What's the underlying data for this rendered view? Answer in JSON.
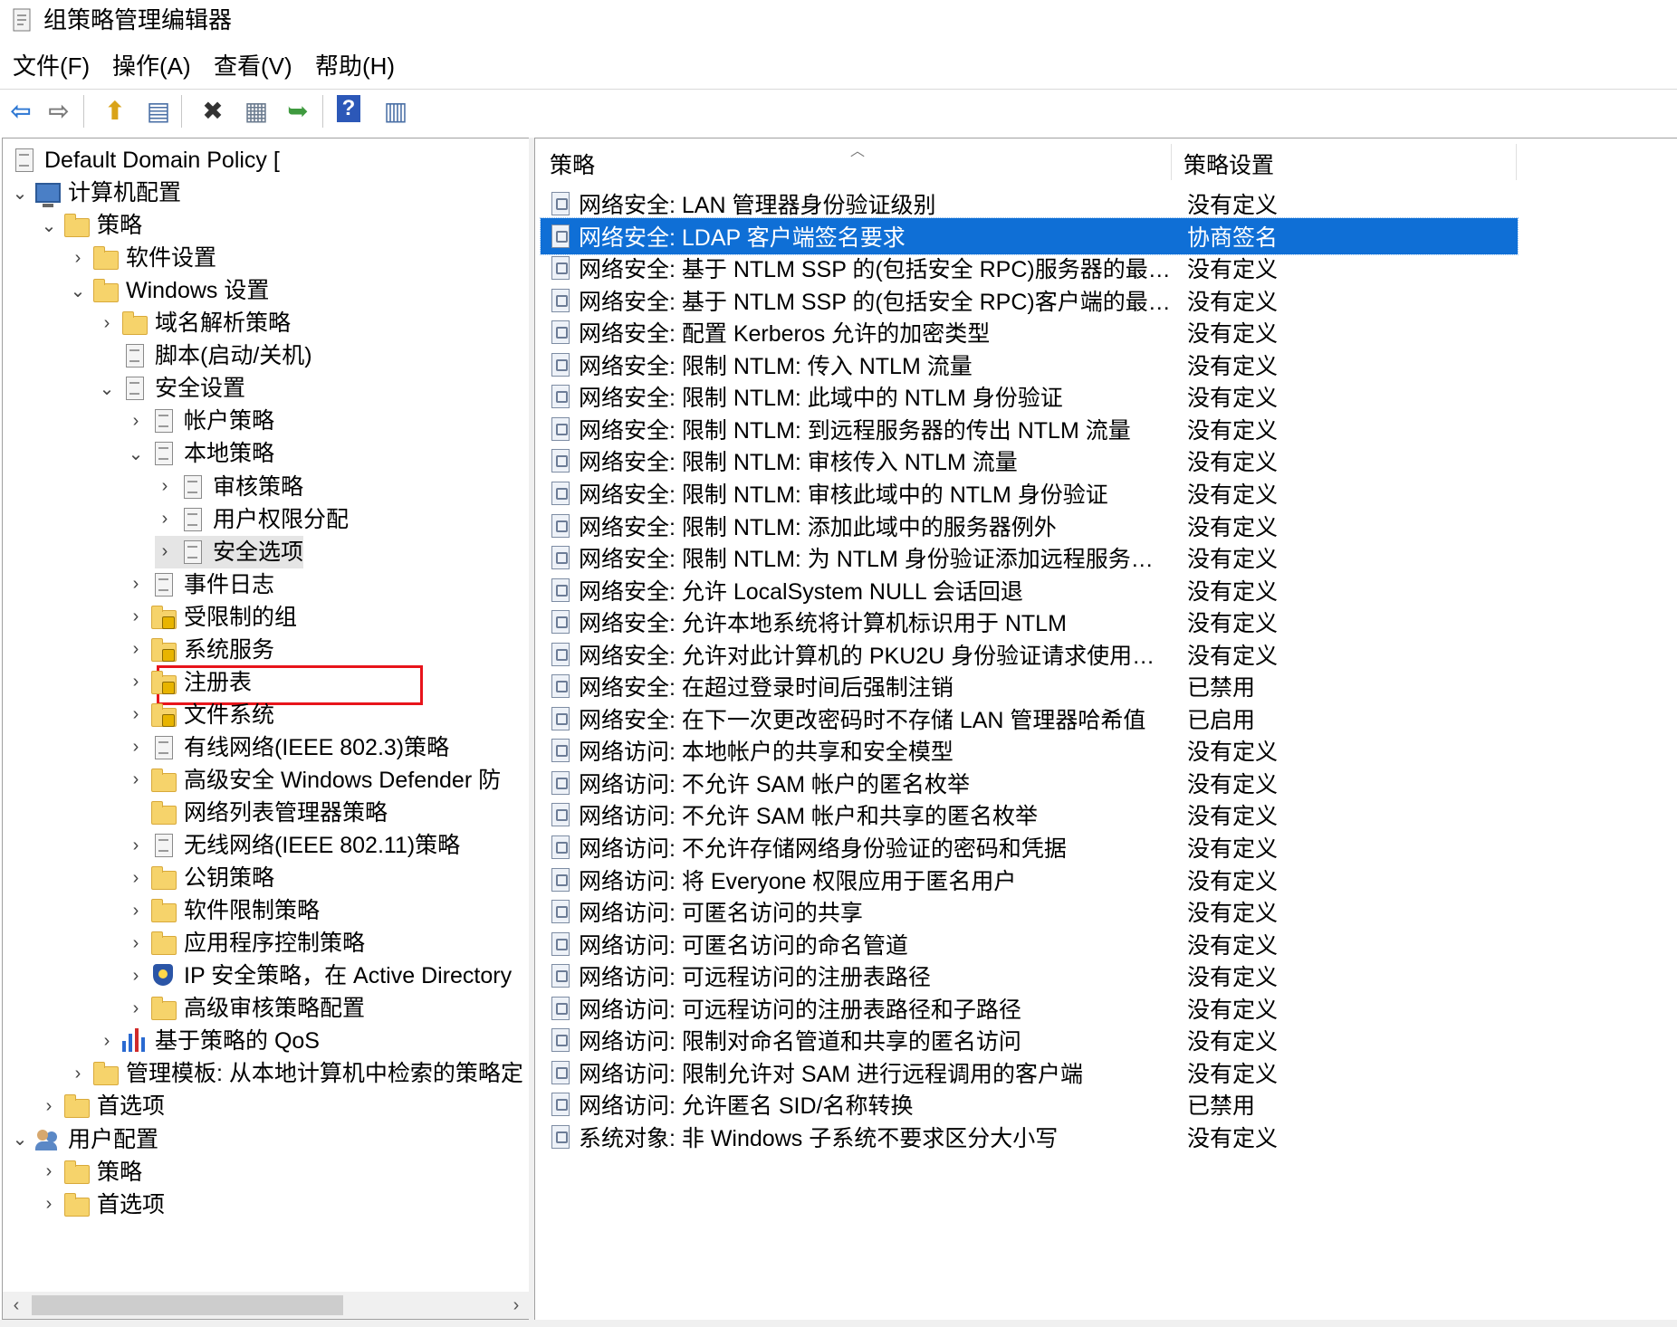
{
  "window": {
    "title": "组策略管理编辑器",
    "icon": "gpo-editor-icon"
  },
  "menu": [
    "文件(F)",
    "操作(A)",
    "查看(V)",
    "帮助(H)"
  ],
  "toolbar": [
    {
      "name": "back-icon",
      "glyph": "⇦",
      "color": "#2d77d3"
    },
    {
      "name": "forward-icon",
      "glyph": "⇨",
      "color": "#7a7a7a"
    },
    {
      "name": "up-folder-icon",
      "glyph": "⬆",
      "color": "#d9a319"
    },
    {
      "name": "show-hide-tree-icon",
      "glyph": "▤",
      "color": "#4a6fa5"
    },
    {
      "name": "delete-icon",
      "glyph": "✖",
      "color": "#333333"
    },
    {
      "name": "properties-icon",
      "glyph": "▦",
      "color": "#6b7b8f"
    },
    {
      "name": "export-list-icon",
      "glyph": "➥",
      "color": "#3f9a3f"
    },
    {
      "name": "help-icon",
      "glyph": "?",
      "color": "#ffffff"
    },
    {
      "name": "view-icon",
      "glyph": "▥",
      "color": "#4a6fa5"
    }
  ],
  "tree": [
    {
      "level": 0,
      "chev": "",
      "icon": "doc",
      "label": "Default Domain Policy [",
      "name": "tree-root-default-domain-policy"
    },
    {
      "level": 0,
      "chev": "v",
      "icon": "pc",
      "label": "计算机配置",
      "name": "tree-computer-config"
    },
    {
      "level": 1,
      "chev": "v",
      "icon": "folder",
      "label": "策略",
      "name": "tree-policies"
    },
    {
      "level": 2,
      "chev": ">",
      "icon": "folder",
      "label": "软件设置",
      "name": "tree-software-settings"
    },
    {
      "level": 2,
      "chev": "v",
      "icon": "folder",
      "label": "Windows 设置",
      "name": "tree-windows-settings"
    },
    {
      "level": 3,
      "chev": ">",
      "icon": "folder",
      "label": "域名解析策略",
      "name": "tree-name-resolution-policy"
    },
    {
      "level": 3,
      "chev": "",
      "icon": "doc",
      "label": "脚本(启动/关机)",
      "name": "tree-scripts"
    },
    {
      "level": 3,
      "chev": "v",
      "icon": "doc",
      "label": "安全设置",
      "name": "tree-security-settings"
    },
    {
      "level": 4,
      "chev": ">",
      "icon": "doc",
      "label": "帐户策略",
      "name": "tree-account-policies"
    },
    {
      "level": 4,
      "chev": "v",
      "icon": "doc",
      "label": "本地策略",
      "name": "tree-local-policies"
    },
    {
      "level": 5,
      "chev": ">",
      "icon": "doc",
      "label": "审核策略",
      "name": "tree-audit-policy"
    },
    {
      "level": 5,
      "chev": ">",
      "icon": "doc",
      "label": "用户权限分配",
      "name": "tree-user-rights"
    },
    {
      "level": 5,
      "chev": ">",
      "icon": "doc",
      "label": "安全选项",
      "name": "tree-security-options",
      "selected": true
    },
    {
      "level": 4,
      "chev": ">",
      "icon": "doc",
      "label": "事件日志",
      "name": "tree-event-log"
    },
    {
      "level": 4,
      "chev": ">",
      "icon": "folderlock",
      "label": "受限制的组",
      "name": "tree-restricted-groups"
    },
    {
      "level": 4,
      "chev": ">",
      "icon": "folderlock",
      "label": "系统服务",
      "name": "tree-system-services"
    },
    {
      "level": 4,
      "chev": ">",
      "icon": "folderlock",
      "label": "注册表",
      "name": "tree-registry"
    },
    {
      "level": 4,
      "chev": ">",
      "icon": "folderlock",
      "label": "文件系统",
      "name": "tree-file-system"
    },
    {
      "level": 4,
      "chev": ">",
      "icon": "doc",
      "label": "有线网络(IEEE 802.3)策略",
      "name": "tree-wired-network"
    },
    {
      "level": 4,
      "chev": ">",
      "icon": "folder",
      "label": "高级安全 Windows Defender 防",
      "name": "tree-defender-firewall"
    },
    {
      "level": 4,
      "chev": "",
      "icon": "folder",
      "label": "网络列表管理器策略",
      "name": "tree-network-list-manager"
    },
    {
      "level": 4,
      "chev": ">",
      "icon": "doc",
      "label": "无线网络(IEEE 802.11)策略",
      "name": "tree-wireless-network"
    },
    {
      "level": 4,
      "chev": ">",
      "icon": "folder",
      "label": "公钥策略",
      "name": "tree-public-key"
    },
    {
      "level": 4,
      "chev": ">",
      "icon": "folder",
      "label": "软件限制策略",
      "name": "tree-software-restriction"
    },
    {
      "level": 4,
      "chev": ">",
      "icon": "folder",
      "label": "应用程序控制策略",
      "name": "tree-app-control"
    },
    {
      "level": 4,
      "chev": ">",
      "icon": "shield",
      "label": "IP 安全策略，在 Active Directory",
      "name": "tree-ip-security"
    },
    {
      "level": 4,
      "chev": ">",
      "icon": "folder",
      "label": "高级审核策略配置",
      "name": "tree-advanced-audit"
    },
    {
      "level": 3,
      "chev": ">",
      "icon": "bars",
      "label": "基于策略的 QoS",
      "name": "tree-qos"
    },
    {
      "level": 2,
      "chev": ">",
      "icon": "folder",
      "label": "管理模板: 从本地计算机中检索的策略定",
      "name": "tree-admin-templates"
    },
    {
      "level": 1,
      "chev": ">",
      "icon": "folder",
      "label": "首选项",
      "name": "tree-computer-preferences"
    },
    {
      "level": 0,
      "chev": "v",
      "icon": "users",
      "label": "用户配置",
      "name": "tree-user-config"
    },
    {
      "level": 1,
      "chev": ">",
      "icon": "folder",
      "label": "策略",
      "name": "tree-user-policies"
    },
    {
      "level": 1,
      "chev": ">",
      "icon": "folder",
      "label": "首选项",
      "name": "tree-user-preferences"
    }
  ],
  "list": {
    "col_policy": "策略",
    "col_setting": "策略设置",
    "rows": [
      {
        "policy": "网络安全: LAN 管理器身份验证级别",
        "setting": "没有定义"
      },
      {
        "policy": "网络安全: LDAP 客户端签名要求",
        "setting": "协商签名",
        "selected": true
      },
      {
        "policy": "网络安全: 基于 NTLM SSP 的(包括安全 RPC)服务器的最小...",
        "setting": "没有定义"
      },
      {
        "policy": "网络安全: 基于 NTLM SSP 的(包括安全 RPC)客户端的最小...",
        "setting": "没有定义"
      },
      {
        "policy": "网络安全: 配置 Kerberos 允许的加密类型",
        "setting": "没有定义"
      },
      {
        "policy": "网络安全: 限制 NTLM: 传入 NTLM 流量",
        "setting": "没有定义"
      },
      {
        "policy": "网络安全: 限制 NTLM: 此域中的 NTLM 身份验证",
        "setting": "没有定义"
      },
      {
        "policy": "网络安全: 限制 NTLM: 到远程服务器的传出 NTLM 流量",
        "setting": "没有定义"
      },
      {
        "policy": "网络安全: 限制 NTLM: 审核传入 NTLM 流量",
        "setting": "没有定义"
      },
      {
        "policy": "网络安全: 限制 NTLM: 审核此域中的 NTLM 身份验证",
        "setting": "没有定义"
      },
      {
        "policy": "网络安全: 限制 NTLM: 添加此域中的服务器例外",
        "setting": "没有定义"
      },
      {
        "policy": "网络安全: 限制 NTLM: 为 NTLM 身份验证添加远程服务器例...",
        "setting": "没有定义"
      },
      {
        "policy": "网络安全: 允许 LocalSystem NULL 会话回退",
        "setting": "没有定义"
      },
      {
        "policy": "网络安全: 允许本地系统将计算机标识用于 NTLM",
        "setting": "没有定义"
      },
      {
        "policy": "网络安全: 允许对此计算机的 PKU2U 身份验证请求使用联机...",
        "setting": "没有定义"
      },
      {
        "policy": "网络安全: 在超过登录时间后强制注销",
        "setting": "已禁用"
      },
      {
        "policy": "网络安全: 在下一次更改密码时不存储 LAN 管理器哈希值",
        "setting": "已启用"
      },
      {
        "policy": "网络访问: 本地帐户的共享和安全模型",
        "setting": "没有定义"
      },
      {
        "policy": "网络访问: 不允许 SAM 帐户的匿名枚举",
        "setting": "没有定义"
      },
      {
        "policy": "网络访问: 不允许 SAM 帐户和共享的匿名枚举",
        "setting": "没有定义"
      },
      {
        "policy": "网络访问: 不允许存储网络身份验证的密码和凭据",
        "setting": "没有定义"
      },
      {
        "policy": "网络访问: 将 Everyone 权限应用于匿名用户",
        "setting": "没有定义"
      },
      {
        "policy": "网络访问: 可匿名访问的共享",
        "setting": "没有定义"
      },
      {
        "policy": "网络访问: 可匿名访问的命名管道",
        "setting": "没有定义"
      },
      {
        "policy": "网络访问: 可远程访问的注册表路径",
        "setting": "没有定义"
      },
      {
        "policy": "网络访问: 可远程访问的注册表路径和子路径",
        "setting": "没有定义"
      },
      {
        "policy": "网络访问: 限制对命名管道和共享的匿名访问",
        "setting": "没有定义"
      },
      {
        "policy": "网络访问: 限制允许对 SAM 进行远程调用的客户端",
        "setting": "没有定义"
      },
      {
        "policy": "网络访问: 允许匿名 SID/名称转换",
        "setting": "已禁用"
      },
      {
        "policy": "系统对象: 非 Windows 子系统不要求区分大小写",
        "setting": "没有定义"
      }
    ]
  },
  "colors": {
    "selection": "#0f6fd6",
    "annotation_box": "#e8141b",
    "folder": "#f6d36b"
  }
}
